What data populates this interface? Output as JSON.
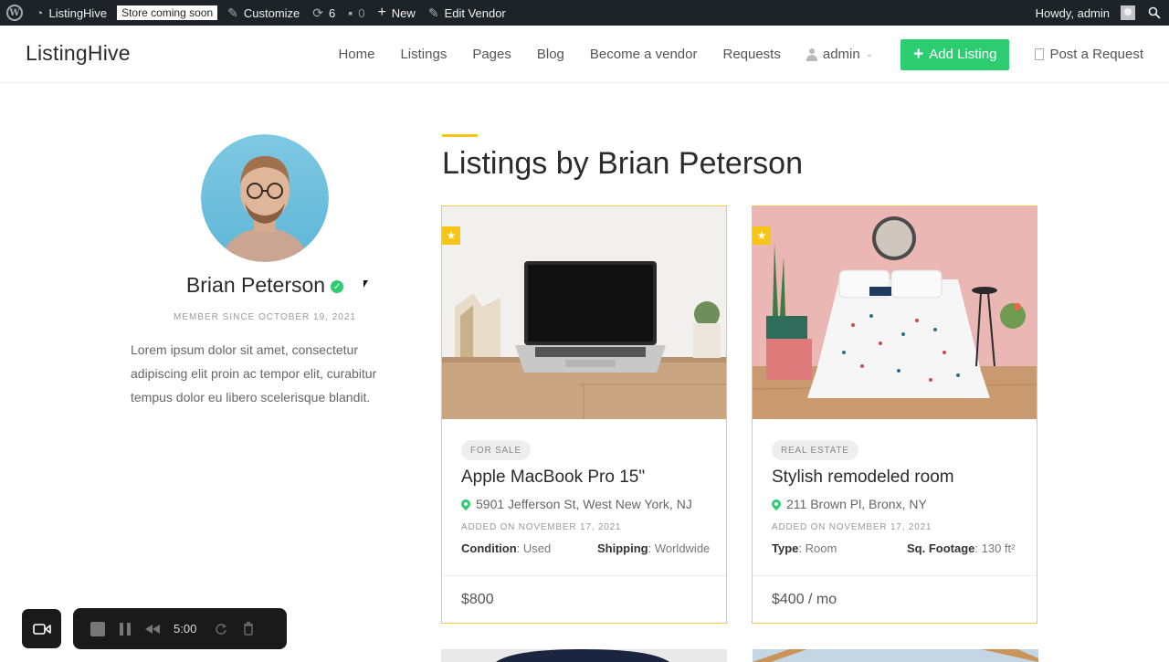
{
  "adminbar": {
    "site_name": "ListingHive",
    "store_badge": "Store coming soon",
    "customize": "Customize",
    "updates_count": "6",
    "comments_count": "0",
    "new": "New",
    "edit_vendor": "Edit Vendor",
    "howdy": "Howdy, admin"
  },
  "header": {
    "logo": "ListingHive",
    "nav": {
      "home": "Home",
      "listings": "Listings",
      "pages": "Pages",
      "blog": "Blog",
      "become_vendor": "Become a vendor",
      "requests": "Requests",
      "user": "admin"
    },
    "add_listing": "Add Listing",
    "post_request": "Post a Request",
    "accent_color": "#2ecc71"
  },
  "profile": {
    "name": "Brian Peterson",
    "member_since": "MEMBER SINCE OCTOBER 19, 2021",
    "bio": "Lorem ipsum dolor sit amet, consectetur adipiscing elit proin ac tempor elit, curabitur tempus dolor eu libero scelerisque blandit."
  },
  "main": {
    "title": "Listings by Brian Peterson",
    "cards": [
      {
        "category": "FOR SALE",
        "title": "Apple MacBook Pro 15\"",
        "location": "5901 Jefferson St, West New York, NJ",
        "added": "ADDED ON NOVEMBER 17, 2021",
        "attr1_label": "Condition",
        "attr1_value": ": Used",
        "attr2_label": "Shipping",
        "attr2_value": ": Worldwide",
        "price": "$800"
      },
      {
        "category": "REAL ESTATE",
        "title": "Stylish remodeled room",
        "location": "211 Brown Pl, Bronx, NY",
        "added": "ADDED ON NOVEMBER 17, 2021",
        "attr1_label": "Type",
        "attr1_value": ": Room",
        "attr2_label": "Sq. Footage",
        "attr2_value": ": 130 ft²",
        "price": "$400 / mo"
      }
    ]
  },
  "recorder": {
    "time": "5:00"
  }
}
